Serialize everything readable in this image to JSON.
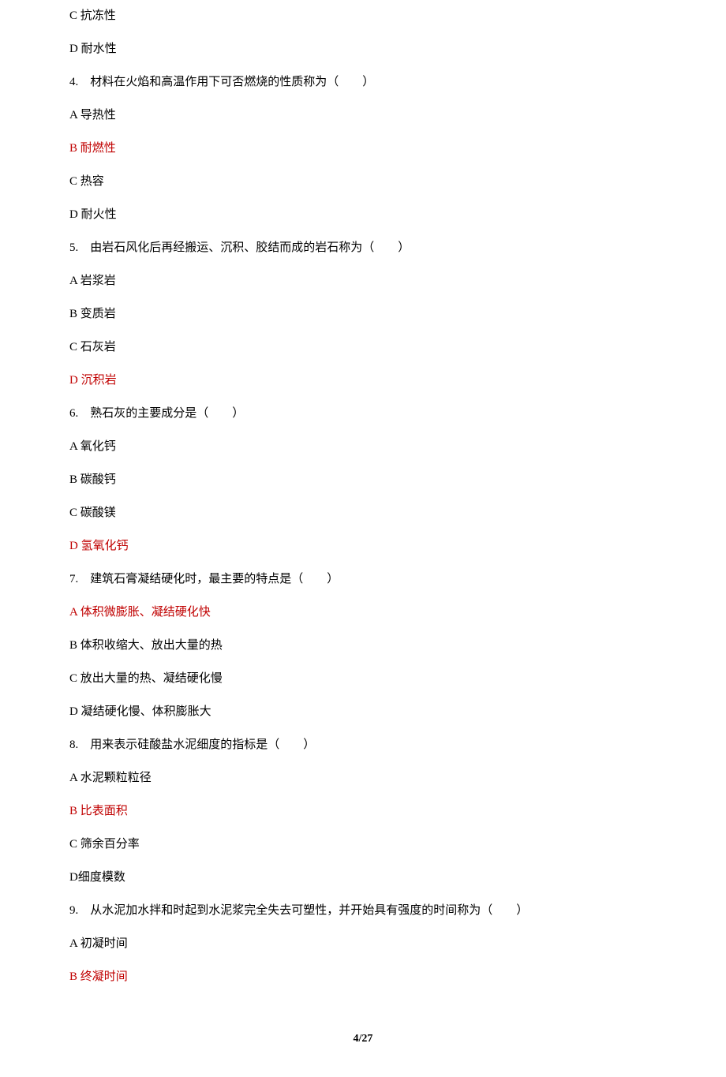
{
  "lines": [
    {
      "text": "C 抗冻性",
      "answer": false
    },
    {
      "text": "D 耐水性",
      "answer": false
    },
    {
      "text": "4.　材料在火焰和高温作用下可否燃烧的性质称为（　　）",
      "answer": false
    },
    {
      "text": "A 导热性",
      "answer": false
    },
    {
      "text": "B 耐燃性",
      "answer": true
    },
    {
      "text": "C 热容",
      "answer": false
    },
    {
      "text": "D 耐火性",
      "answer": false
    },
    {
      "text": "5.　由岩石风化后再经搬运、沉积、胶结而成的岩石称为（　　）",
      "answer": false
    },
    {
      "text": "A 岩浆岩",
      "answer": false
    },
    {
      "text": "B 变质岩",
      "answer": false
    },
    {
      "text": "C 石灰岩",
      "answer": false
    },
    {
      "text": "D 沉积岩",
      "answer": true
    },
    {
      "text": "6.　熟石灰的主要成分是（　　）",
      "answer": false
    },
    {
      "text": "A 氧化钙",
      "answer": false
    },
    {
      "text": "B 碳酸钙",
      "answer": false
    },
    {
      "text": "C 碳酸镁",
      "answer": false
    },
    {
      "text": "D 氢氧化钙",
      "answer": true
    },
    {
      "text": "7.　建筑石膏凝结硬化时，最主要的特点是（　　）",
      "answer": false
    },
    {
      "text": "A 体积微膨胀、凝结硬化快",
      "answer": true
    },
    {
      "text": "B 体积收缩大、放出大量的热",
      "answer": false
    },
    {
      "text": "C 放出大量的热、凝结硬化慢",
      "answer": false
    },
    {
      "text": "D 凝结硬化慢、体积膨胀大",
      "answer": false
    },
    {
      "text": "8.　用来表示硅酸盐水泥细度的指标是（　　）",
      "answer": false
    },
    {
      "text": "A 水泥颗粒粒径",
      "answer": false
    },
    {
      "text": "B 比表面积",
      "answer": true
    },
    {
      "text": "C 筛余百分率",
      "answer": false
    },
    {
      "text": "D细度模数",
      "answer": false
    },
    {
      "text": "9.　从水泥加水拌和时起到水泥浆完全失去可塑性，并开始具有强度的时间称为（　　）",
      "answer": false
    },
    {
      "text": "A 初凝时间",
      "answer": false
    },
    {
      "text": "B 终凝时间",
      "answer": true
    }
  ],
  "footer": "4/27"
}
